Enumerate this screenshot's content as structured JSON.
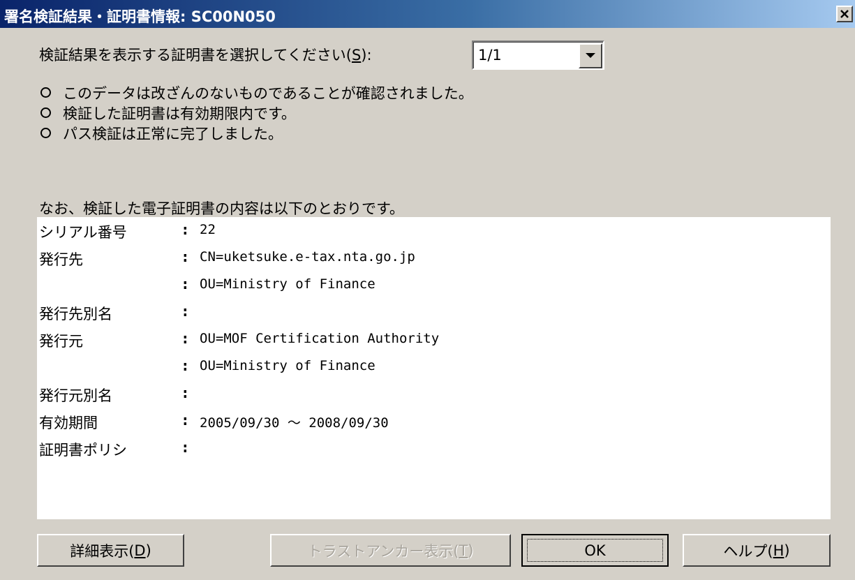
{
  "window": {
    "title": "署名検証結果・証明書情報: SC00N050",
    "close_icon": "close-icon"
  },
  "selector": {
    "prompt_text": "検証結果を表示する証明書を選択してください(",
    "prompt_key": "S",
    "prompt_suffix": "):",
    "value": "1/1"
  },
  "status_messages": [
    "このデータは改ざんのないものであることが確認されました。",
    "検証した証明書は有効期限内です。",
    "パス検証は正常に完了しました。"
  ],
  "note": "なお、検証した電子証明書の内容は以下のとおりです。",
  "certificate": {
    "colon": ":",
    "rows": [
      {
        "label": "シリアル番号",
        "value": "22"
      },
      {
        "label": "発行先",
        "value": "CN=uketsuke.e-tax.nta.go.jp"
      },
      {
        "label": "",
        "value": "OU=Ministry of Finance"
      },
      {
        "label": "発行先別名",
        "value": ""
      },
      {
        "label": "発行元",
        "value": "OU=MOF Certification Authority"
      },
      {
        "label": "",
        "value": "OU=Ministry of Finance"
      },
      {
        "label": "発行元別名",
        "value": ""
      },
      {
        "label": "有効期間",
        "value": "2005/09/30  〜  2008/09/30"
      },
      {
        "label": "証明書ポリシ",
        "value": ""
      }
    ]
  },
  "buttons": {
    "details": {
      "text": "詳細表示(",
      "key": "D",
      "suffix": ")"
    },
    "trust_anchor": {
      "text": "トラストアンカー表示(",
      "key": "T",
      "suffix": ")"
    },
    "ok": {
      "text": "OK"
    },
    "help": {
      "text": "ヘルプ(",
      "key": "H",
      "suffix": ")"
    }
  }
}
